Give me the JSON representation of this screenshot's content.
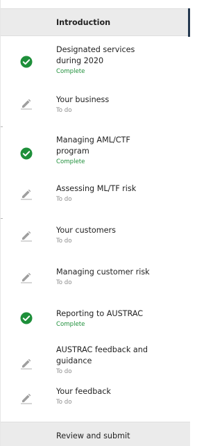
{
  "colors": {
    "complete_green": "#1e8f3a",
    "todo_grey": "#8c8c8c",
    "accent_navy": "#24384f",
    "header_bg": "#ebebeb"
  },
  "nav": {
    "header": {
      "label": "Introduction"
    },
    "items": [
      {
        "label_lines": [
          "Designated services",
          "during 2020"
        ],
        "status": "Complete",
        "icon": "check-circle-icon"
      },
      {
        "label_lines": [
          "Your business"
        ],
        "status": "To do",
        "icon": "pencil-icon"
      },
      {
        "label_lines": [
          "Managing AML/CTF",
          "program"
        ],
        "status": "Complete",
        "icon": "check-circle-icon"
      },
      {
        "label_lines": [
          "Assessing ML/TF risk"
        ],
        "status": "To do",
        "icon": "pencil-icon"
      },
      {
        "label_lines": [
          "Your customers"
        ],
        "status": "To do",
        "icon": "pencil-icon"
      },
      {
        "label_lines": [
          "Managing customer risk"
        ],
        "status": "To do",
        "icon": "pencil-icon"
      },
      {
        "label_lines": [
          "Reporting to AUSTRAC"
        ],
        "status": "Complete",
        "icon": "check-circle-icon"
      },
      {
        "label_lines": [
          "AUSTRAC feedback and",
          "guidance"
        ],
        "status": "To do",
        "icon": "pencil-icon"
      },
      {
        "label_lines": [
          "Your feedback"
        ],
        "status": "To do",
        "icon": "pencil-icon"
      }
    ],
    "footer": {
      "label": "Review and submit"
    }
  }
}
